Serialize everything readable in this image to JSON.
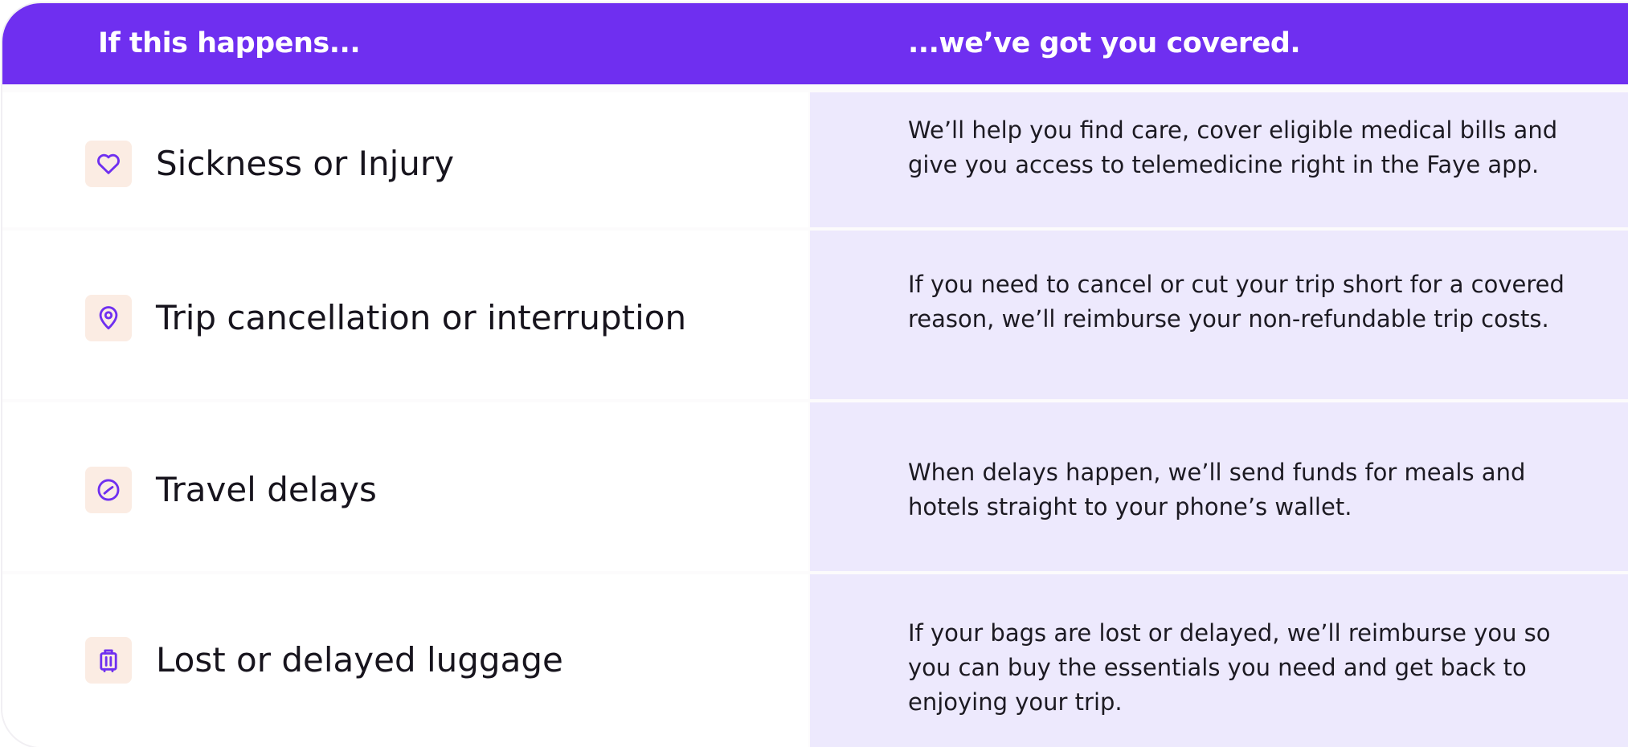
{
  "header": {
    "left_label": "If this happens...",
    "right_label": "...we’ve got you covered."
  },
  "rows": [
    {
      "title": "Sickness or Injury",
      "icon": "heart-icon",
      "description": "We’ll help you find care, cover eligible medical bills and give you access to telemedicine right in the Faye app."
    },
    {
      "title": "Trip cancellation or interruption",
      "icon": "location-pin-icon",
      "description": "If you need to cancel or cut your trip short for a covered reason, we’ll reimburse your non-refundable trip costs."
    },
    {
      "title": "Travel delays",
      "icon": "clock-icon",
      "description": "When delays happen, we’ll send funds for meals and hotels straight to your phone’s wallet."
    },
    {
      "title": "Lost or delayed luggage",
      "icon": "luggage-icon",
      "description": "If your bags are lost or delayed, we’ll reimburse you so you can buy the essentials you need and get back to enjoying your trip."
    }
  ],
  "colors": {
    "header_background": "#6f2ff0",
    "header_text": "#ffffff",
    "left_cell_background": "#ffffff",
    "right_cell_background": "#ede9fd",
    "icon_tile_background": "#fbece3",
    "icon_stroke": "#6f2ff0",
    "text": "#17141d"
  }
}
